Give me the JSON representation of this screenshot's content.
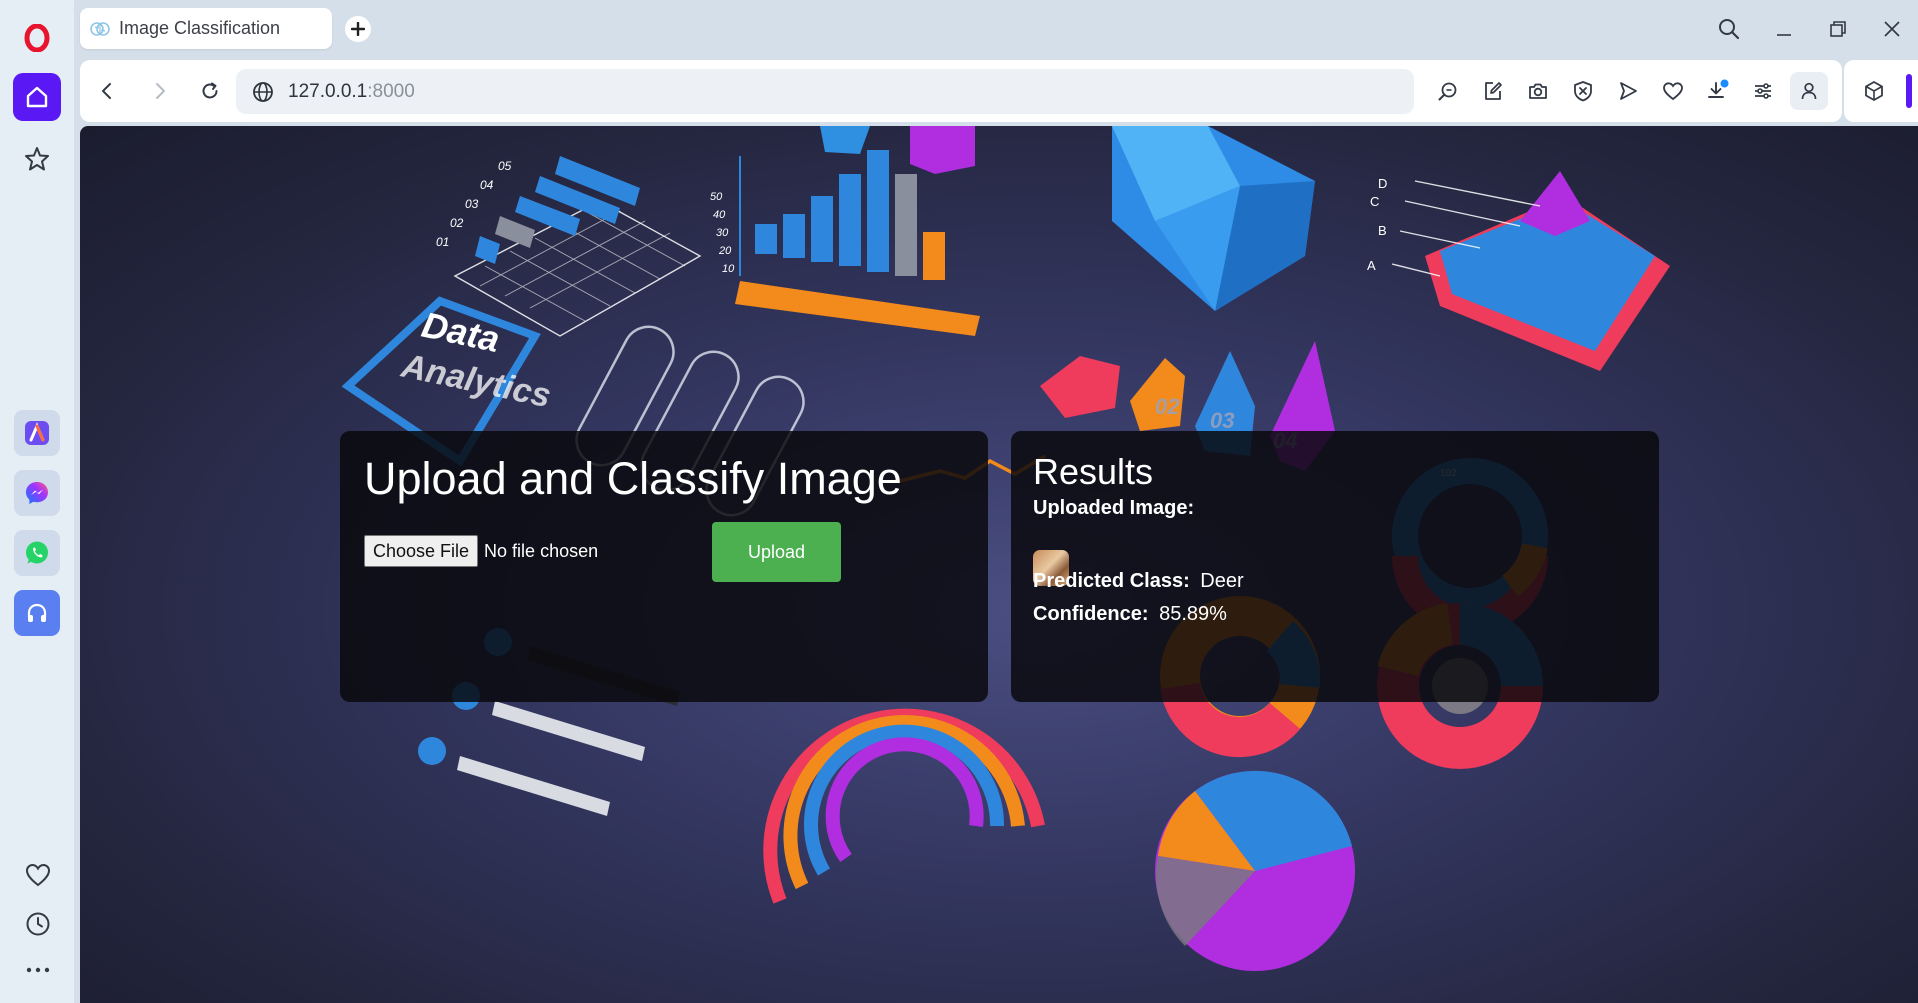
{
  "browser": {
    "tab_title": "Image Classification",
    "url_host": "127.0.0.1",
    "url_port": ":8000",
    "sidebar_icons": [
      "opera-logo-icon",
      "home-icon",
      "star-icon",
      "aria-icon",
      "messenger-icon",
      "whatsapp-icon",
      "music-player-icon",
      "heart-icon",
      "history-icon",
      "more-icon"
    ],
    "toolbar_icons": [
      "search-tabs-icon",
      "edit-icon",
      "camera-icon",
      "adblock-icon",
      "send-icon",
      "heart-icon",
      "download-icon",
      "easy-setup-icon",
      "profile-icon",
      "cube-icon"
    ],
    "accent_color": "#5a18f5"
  },
  "upload_panel": {
    "heading": "Upload and Classify Image",
    "choose_file_label": "Choose File",
    "file_status": "No file chosen",
    "upload_label": "Upload",
    "upload_color": "#4caf50"
  },
  "results_panel": {
    "heading": "Results",
    "uploaded_image_label": "Uploaded Image:",
    "predicted_class_label": "Predicted Class:",
    "predicted_class_value": "Deer",
    "confidence_label": "Confidence:",
    "confidence_value": "85.89%"
  },
  "background": {
    "title_line1": "Data",
    "title_line2": "Analytics",
    "bar_axis_ticks": [
      "05",
      "04",
      "03",
      "02",
      "01"
    ],
    "column_axis_ticks": [
      "50",
      "40",
      "30",
      "20",
      "10"
    ],
    "pyramid_labels": [
      "D",
      "C",
      "B",
      "A"
    ],
    "donut_label": "102",
    "step_labels": [
      "02",
      "03",
      "04"
    ]
  }
}
